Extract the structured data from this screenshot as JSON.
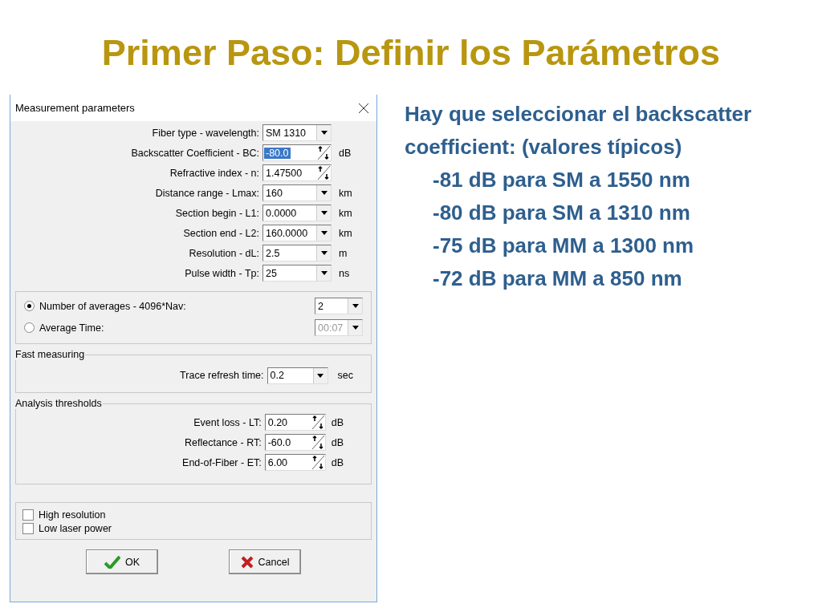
{
  "slide_title": "Primer Paso: Definir los Parámetros",
  "dialog": {
    "title": "Measurement parameters",
    "fields": [
      {
        "label": "Fiber type - wavelength:",
        "value": "SM 1310",
        "kind": "dropdown",
        "highlighted": false
      },
      {
        "label": "Backscatter Coefficient - BC:",
        "value": "-80.0",
        "kind": "spin",
        "unit": "dB",
        "highlighted": true
      },
      {
        "label": "Refractive index - n:",
        "value": "1.47500",
        "kind": "spin",
        "highlighted": false
      },
      {
        "label": "Distance range - Lmax:",
        "value": "160",
        "kind": "dropdown",
        "unit": "km",
        "highlighted": false
      },
      {
        "label": "Section begin - L1:",
        "value": "0.0000",
        "kind": "dropdown",
        "unit": "km",
        "highlighted": false
      },
      {
        "label": "Section end - L2:",
        "value": "160.0000",
        "kind": "dropdown",
        "unit": "km",
        "highlighted": false
      },
      {
        "label": "Resolution - dL:",
        "value": "2.5",
        "kind": "dropdown",
        "unit": "m",
        "highlighted": false
      },
      {
        "label": "Pulse width - Tp:",
        "value": "25",
        "kind": "dropdown",
        "unit": "ns",
        "highlighted": false
      }
    ],
    "averaging": [
      {
        "label": "Number of averages - 4096*Nav:",
        "value": "2",
        "selected": true,
        "disabled": false
      },
      {
        "label": "Average Time:",
        "value": "00:07",
        "selected": false,
        "disabled": true
      }
    ],
    "fast_measuring": {
      "title": "Fast measuring",
      "label": "Trace refresh time:",
      "value": "0.2",
      "unit": "sec"
    },
    "analysis_thresholds": {
      "title": "Analysis thresholds",
      "fields": [
        {
          "label": "Event loss - LT:",
          "value": "0.20",
          "unit": "dB"
        },
        {
          "label": "Reflectance - RT:",
          "value": "-60.0",
          "unit": "dB"
        },
        {
          "label": "End-of-Fiber - ET:",
          "value": "6.00",
          "unit": "dB"
        }
      ]
    },
    "options": [
      {
        "label": "High resolution",
        "checked": false
      },
      {
        "label": "Low laser power",
        "checked": false
      }
    ],
    "buttons": [
      {
        "label": "OK",
        "kind": "ok"
      },
      {
        "label": "Cancel",
        "kind": "cancel"
      }
    ]
  },
  "notes": [
    {
      "text": "Hay que seleccionar el backscatter coefficient: (valores típicos)",
      "indented": false
    },
    {
      "text": "-81 dB para SM a 1550 nm",
      "indented": true
    },
    {
      "text": "-80 dB para SM a 1310 nm",
      "indented": true
    },
    {
      "text": "-75 dB para MM a 1300 nm",
      "indented": true
    },
    {
      "text": "-72 dB para MM a 850 nm",
      "indented": true
    }
  ]
}
